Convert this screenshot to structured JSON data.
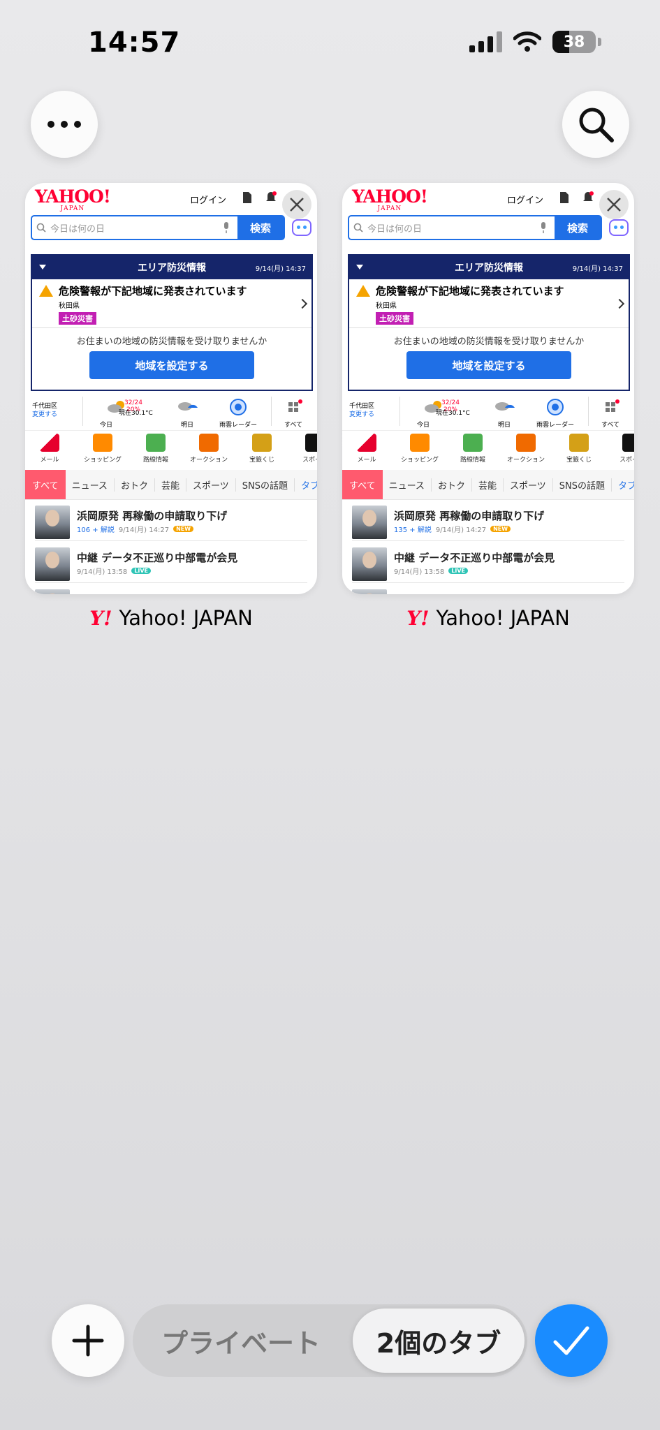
{
  "status": {
    "time": "14:57",
    "battery": "38"
  },
  "tabs": [
    {
      "title": "Yahoo! JAPAN",
      "logo": "YAHOO!",
      "logo_sub": "JAPAN",
      "login": "ログイン",
      "search_placeholder": "今日は何の日",
      "search_button": "検索",
      "alert_header": "エリア防災情報",
      "alert_date": "9/14(月) 14:37",
      "alert_message": "危険警報が下記地域に発表されています",
      "alert_pref": "秋田県",
      "alert_tag": "土砂災害",
      "alert_footer": "お住まいの地域の防災情報を受け取りませんか",
      "alert_button": "地域を設定する",
      "weather": {
        "loc": "千代田区",
        "loc_change": "変更する",
        "temp": "32/24 20%",
        "now": "現在30.1°C",
        "today": "今日",
        "tomorrow": "明日",
        "radar": "雨雲レーダー",
        "all": "すべて"
      },
      "services": [
        "メール",
        "ショッピング",
        "路線情報",
        "オークション",
        "宝籤くじ",
        "スポーツ"
      ],
      "news_tabs": [
        "すべて",
        "ニュース",
        "おトク",
        "芸能",
        "スポーツ",
        "SNSの話題",
        "タブ"
      ],
      "news": [
        {
          "headline": "浜岡原発 再稼働の申請取り下げ",
          "comments": "106 + 解説",
          "time": "9/14(月) 14:27",
          "badge": "NEW"
        },
        {
          "headline": "中継 データ不正巡り中部電が会見",
          "comments": "",
          "time": "9/14(月) 13:58",
          "badge": "LIVE"
        }
      ]
    },
    {
      "title": "Yahoo! JAPAN",
      "logo": "YAHOO!",
      "logo_sub": "JAPAN",
      "login": "ログイン",
      "search_placeholder": "今日は何の日",
      "search_button": "検索",
      "alert_header": "エリア防災情報",
      "alert_date": "9/14(月) 14:37",
      "alert_message": "危険警報が下記地域に発表されています",
      "alert_pref": "秋田県",
      "alert_tag": "土砂災害",
      "alert_footer": "お住まいの地域の防災情報を受け取りませんか",
      "alert_button": "地域を設定する",
      "weather": {
        "loc": "千代田区",
        "loc_change": "変更する",
        "temp": "32/24 20%",
        "now": "現在30.1°C",
        "today": "今日",
        "tomorrow": "明日",
        "radar": "雨雲レーダー",
        "all": "すべて"
      },
      "services": [
        "メール",
        "ショッピング",
        "路線情報",
        "オークション",
        "宝籤くじ",
        "スポーツ"
      ],
      "news_tabs": [
        "すべて",
        "ニュース",
        "おトク",
        "芸能",
        "スポーツ",
        "SNSの話題",
        "タブ"
      ],
      "news": [
        {
          "headline": "浜岡原発 再稼働の申請取り下げ",
          "comments": "135 + 解説",
          "time": "9/14(月) 14:27",
          "badge": "NEW"
        },
        {
          "headline": "中継 データ不正巡り中部電が会見",
          "comments": "",
          "time": "9/14(月) 13:58",
          "badge": "LIVE"
        }
      ]
    }
  ],
  "toolbar": {
    "private": "プライベート",
    "tab_count": "2個のタブ",
    "mini_logo": "Y!"
  },
  "colors": {
    "accent": "#1a8cff",
    "yahoo_red": "#ff0033",
    "alert_navy": "#15256a"
  },
  "icons": [
    "more-icon",
    "search-icon",
    "close-icon",
    "plus-icon",
    "checkmark-icon"
  ]
}
